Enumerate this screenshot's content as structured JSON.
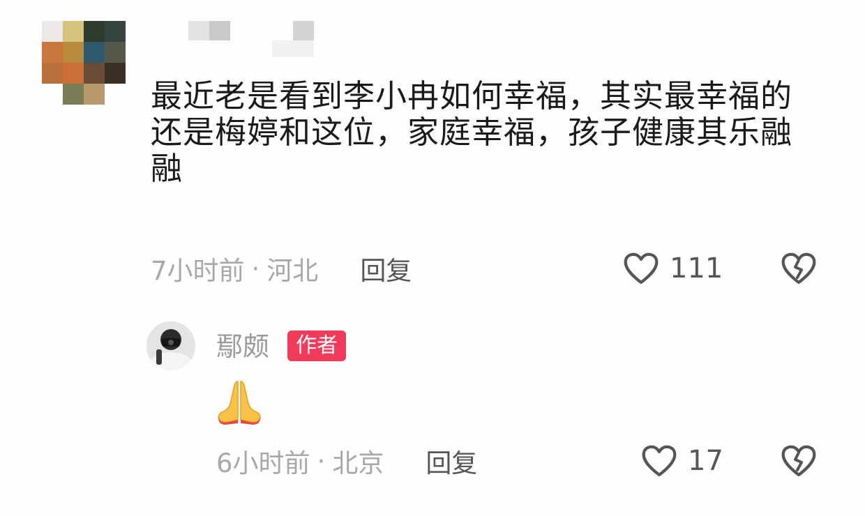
{
  "comment": {
    "text": "最近老是看到李小冉如何幸福，其实最幸福的还是梅婷和这位，家庭幸福，孩子健康其乐融融",
    "time": "7小时前",
    "location": "河北",
    "separator": "·",
    "reply_label": "回复",
    "likes": "111",
    "avatar_icon": "pixelated-avatar",
    "username_redacted": true
  },
  "reply": {
    "author": "鄢颇",
    "badge": "作者",
    "emoji": "🙏",
    "time": "6小时前",
    "location": "北京",
    "separator": "·",
    "reply_label": "回复",
    "likes": "17"
  },
  "colors": {
    "badge_bg": "#f23a5b",
    "meta_text": "#a8a8a8",
    "main_text": "#1a1a1a"
  }
}
